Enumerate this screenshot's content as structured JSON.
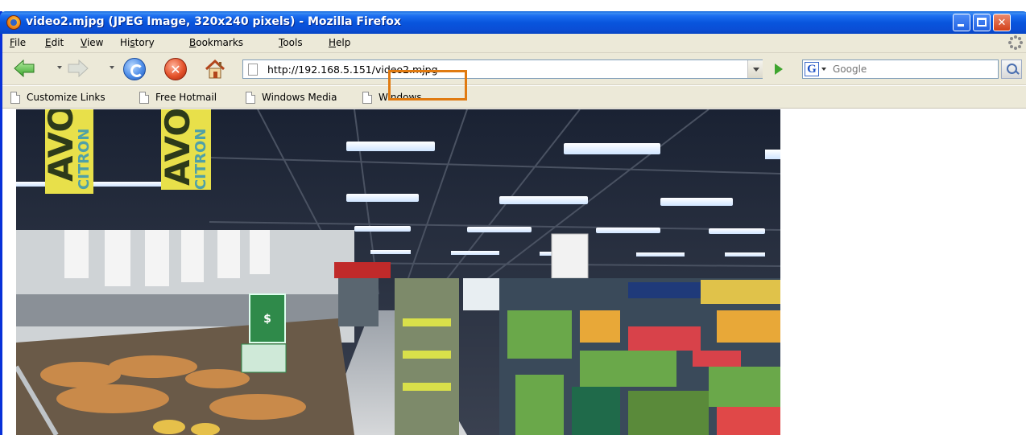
{
  "caption_fragment": "",
  "window": {
    "title": "video2.mjpg (JPEG Image, 320x240 pixels) - Mozilla Firefox"
  },
  "menu": {
    "items": [
      {
        "label": "File",
        "accel": "F",
        "rest": "ile"
      },
      {
        "label": "Edit",
        "accel": "E",
        "rest": "dit"
      },
      {
        "label": "View",
        "accel": "V",
        "rest": "iew"
      },
      {
        "label": "History",
        "pre": "Hi",
        "accel": "s",
        "rest": "tory"
      },
      {
        "label": "Bookmarks",
        "accel": "B",
        "rest": "ookmarks"
      },
      {
        "label": "Tools",
        "accel": "T",
        "rest": "ools"
      },
      {
        "label": "Help",
        "accel": "H",
        "rest": "elp"
      }
    ]
  },
  "navigation": {
    "url": "http://192.168.5.151/video2.mjpg",
    "search_placeholder": "Google",
    "search_engine_letter": "G"
  },
  "bookmarks": {
    "items": [
      "Customize Links",
      "Free Hotmail",
      "Windows Media",
      "Windows"
    ]
  },
  "image": {
    "banner_text_1": "AVOC",
    "banner_text_2": "CITRON",
    "description_hidden": "",
    "price_sign": "$"
  },
  "colors": {
    "titlebar": "#0855dd",
    "chrome": "#ece9d8",
    "highlight_box": "#e07a10",
    "go_arrow": "#3ea52e"
  },
  "icons": [
    "firefox-icon",
    "back-arrow-icon",
    "forward-arrow-icon",
    "reload-icon",
    "stop-icon",
    "home-icon",
    "page-icon",
    "go-arrow-icon",
    "search-icon",
    "throbber-icon"
  ]
}
